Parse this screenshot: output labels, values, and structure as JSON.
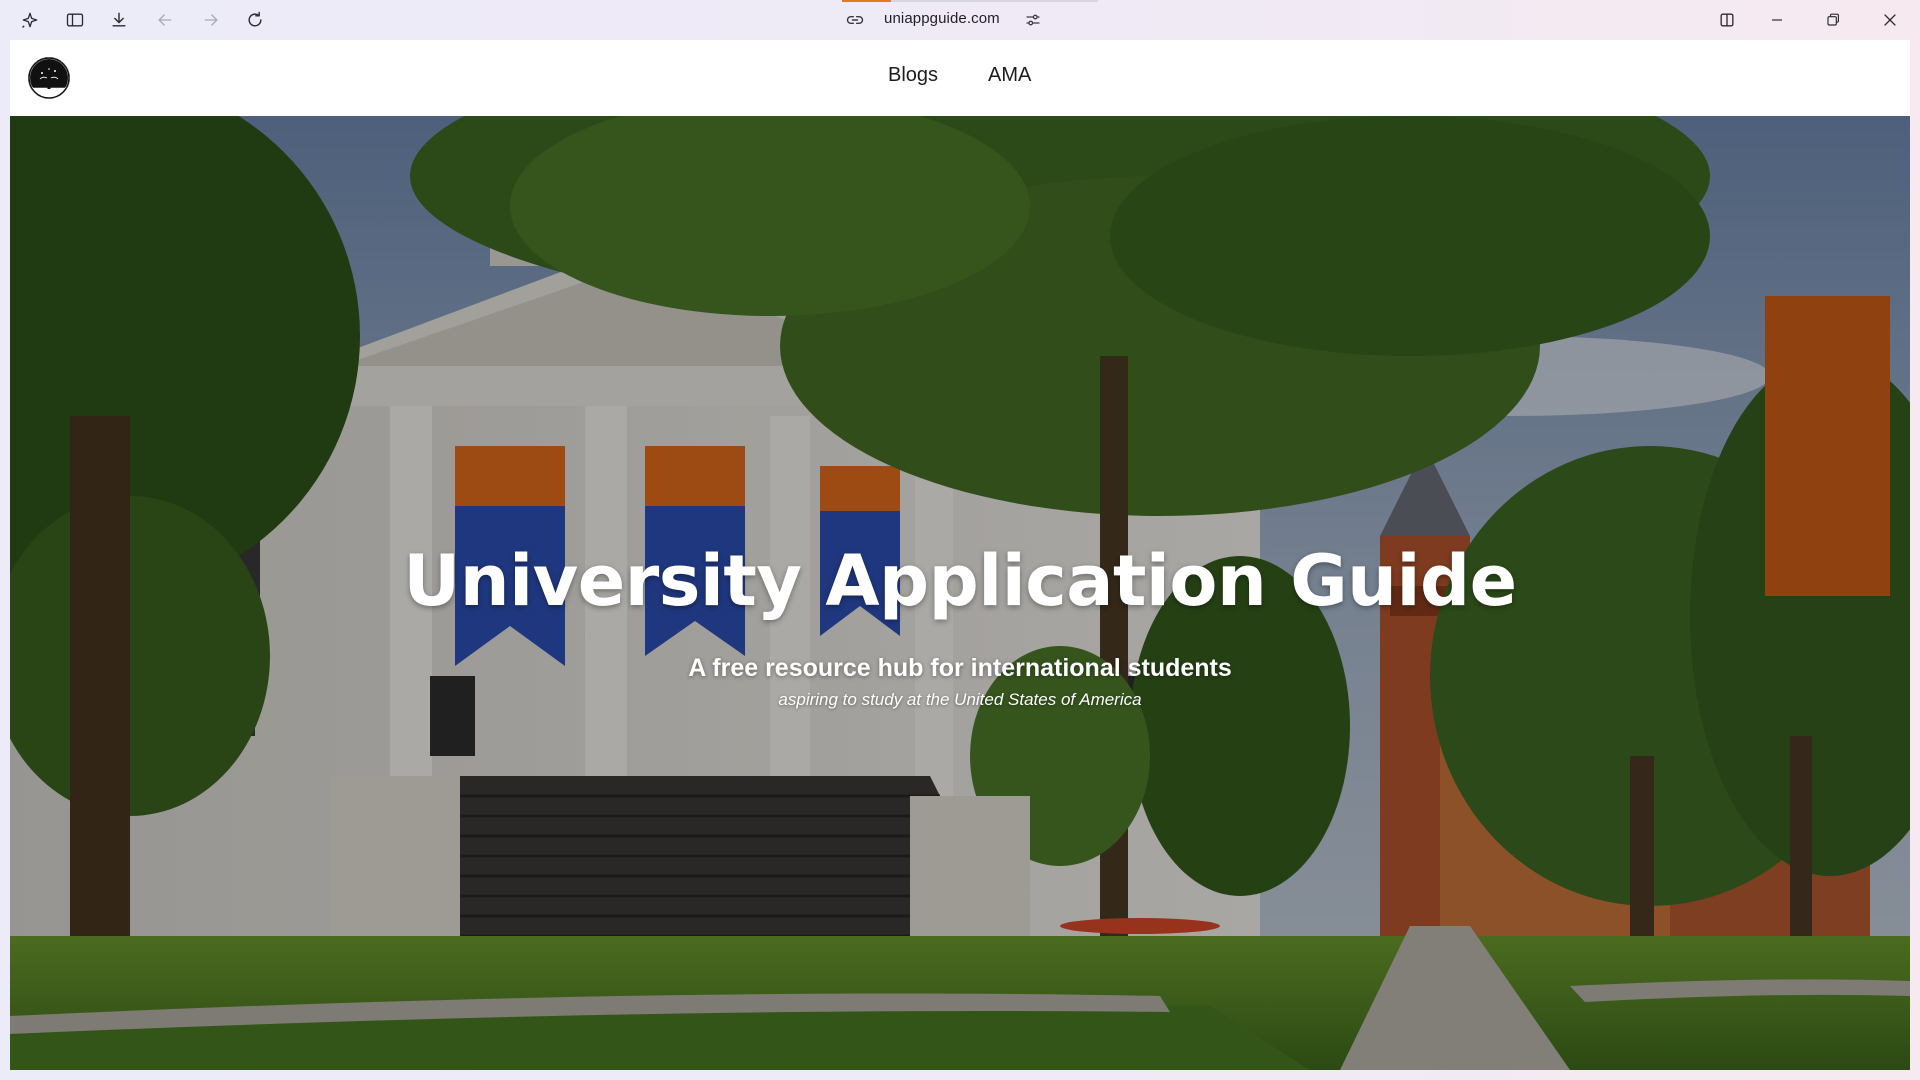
{
  "browser": {
    "url": "uniappguide.com",
    "load_progress": 0.19,
    "icons": {
      "app_menu": "ai-sparkle-icon",
      "sidebar": "sidebar-toggle-icon",
      "downloads": "download-icon",
      "back": "back-arrow-icon",
      "forward": "forward-arrow-icon",
      "reload": "reload-icon",
      "site_info": "link-icon",
      "site_settings": "tune-icon",
      "split_view": "split-view-icon",
      "minimize": "minimize-icon",
      "restore": "restore-icon",
      "close": "close-icon"
    },
    "back_enabled": false,
    "forward_enabled": false
  },
  "site": {
    "logo_icon": "tree-logo-icon",
    "nav": [
      {
        "label": "Blogs"
      },
      {
        "label": "AMA"
      }
    ]
  },
  "hero": {
    "title": "University Application Guide",
    "subtitle": "A free resource hub for international students",
    "tagline": "aspiring to study at the United States of America"
  },
  "colors": {
    "chrome_bg_start": "#ecebf8",
    "chrome_bg_end": "#f6eaf0",
    "loading_accent": "#e07b20",
    "hero_text": "#ffffff",
    "nav_text": "#1d1d1d"
  }
}
